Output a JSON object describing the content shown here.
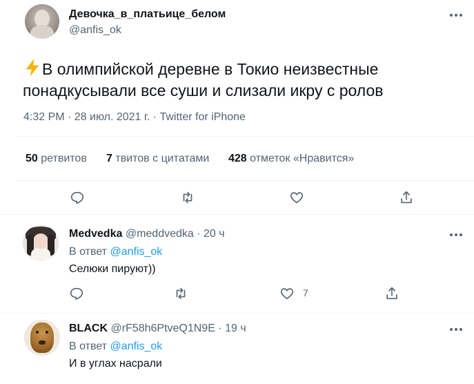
{
  "main_tweet": {
    "author_name": "Девочка_в_платьице_белом",
    "author_handle": "@anfis_ok",
    "text_line1": "В олимпийской деревне в Токио неизвестные",
    "text_line2": "понадкусывали все суши и слизали икру с ролов",
    "meta": "4:32 PM · 28 июл. 2021 г. · Twitter for iPhone",
    "stats": {
      "retweets_count": "50",
      "retweets_label": "ретвитов",
      "quotes_count": "7",
      "quotes_label": "твитов с цитатами",
      "likes_count": "428",
      "likes_label": "отметок «Нравится»"
    }
  },
  "replies": [
    {
      "name": "Medvedka",
      "handle": "@meddvedka",
      "time": "· 20 ч",
      "reply_to_prefix": "В ответ",
      "reply_to_handle": "@anfis_ok",
      "text": "Селюки пируют))",
      "likes": "7"
    },
    {
      "name": "BLACK",
      "handle": "@rF58h6PtveQ1N9E",
      "time": "· 19 ч",
      "reply_to_prefix": "В ответ",
      "reply_to_handle": "@anfis_ok",
      "text": "И в углах насрали"
    }
  ],
  "colors": {
    "accent": "#1d9bf0",
    "muted": "#536471",
    "lightning": "#f4b400"
  },
  "icons": [
    "more-icon",
    "lightning-icon",
    "reply-icon",
    "retweet-icon",
    "like-icon",
    "share-icon"
  ]
}
